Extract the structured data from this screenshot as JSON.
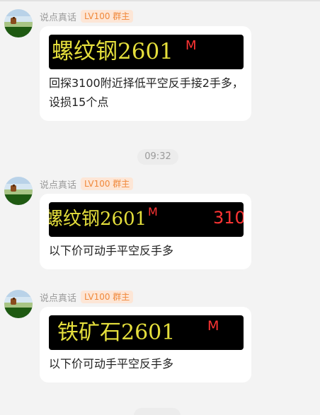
{
  "messages": [
    {
      "sender": "说点真话",
      "badge": "LV100 群主",
      "quote": {
        "name": "螺纹钢2601",
        "flag": "M",
        "price": ""
      },
      "text": "回探3100附近择低平空反手接2手多，设损15个点"
    },
    {
      "sender": "说点真话",
      "badge": "LV100 群主",
      "quote": {
        "name": "螺纹钢2601",
        "flag": "M",
        "price": "310"
      },
      "text": "以下价可动手平空反手多"
    },
    {
      "sender": "说点真话",
      "badge": "LV100 群主",
      "quote": {
        "name": "铁矿石2601",
        "flag": "M",
        "price": ""
      },
      "text": "以下价可动手平空反手多"
    }
  ],
  "timestamp": "09:32",
  "colors": {
    "background": "#f3f3f3",
    "bubble": "#ffffff",
    "badge_bg": "#fde6d6",
    "badge_text": "#f0883a",
    "quote_bg": "#000000",
    "quote_name": "#e5df3c",
    "quote_red": "#ff3434"
  },
  "icons": {
    "avatar": "landscape-avatar-icon"
  }
}
